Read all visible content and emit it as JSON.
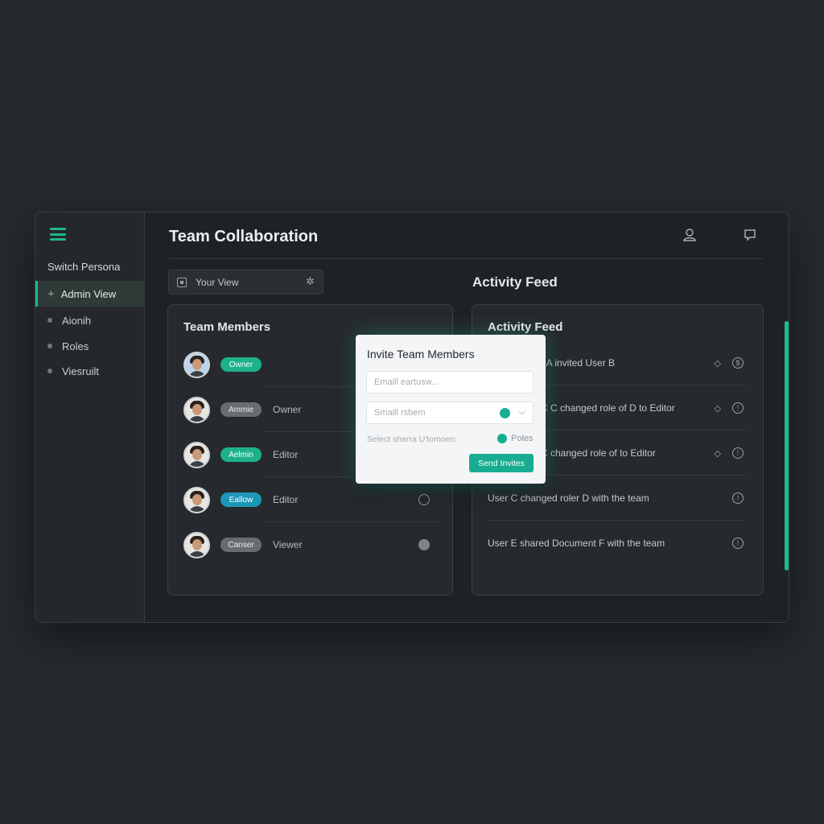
{
  "sidebar": {
    "switch_label": "Switch Persona",
    "items": [
      {
        "label": "Admin View",
        "active": true
      },
      {
        "label": "Aionih"
      },
      {
        "label": "Roles"
      },
      {
        "label": "Viesruilt"
      }
    ]
  },
  "header": {
    "title": "Team Collaboration"
  },
  "view": {
    "label": "Your View"
  },
  "activity": {
    "heading": "Activity Feed",
    "panel_title": "Activity Feed",
    "items": [
      {
        "text": "r A invited User B",
        "diamond": true
      },
      {
        "text": "C C changed role of D to Editor",
        "diamond": true
      },
      {
        "text": "C changed role of to Editor",
        "diamond": true
      },
      {
        "text": "User C changed roler D with the team",
        "diamond": false
      },
      {
        "text": "User E shared Document F with the team",
        "diamond": false
      }
    ]
  },
  "members": {
    "title": "Team Members",
    "rows": [
      {
        "badge": "Owner",
        "badge_style": "green",
        "role": "",
        "radio": "none"
      },
      {
        "badge": "Ammie",
        "badge_style": "grey",
        "role": "Owner",
        "radio": "none"
      },
      {
        "badge": "Aelmin",
        "badge_style": "green",
        "role": "Editor",
        "radio": "none"
      },
      {
        "badge": "Eallow",
        "badge_style": "teal",
        "role": "Editor",
        "radio": "empty"
      },
      {
        "badge": "Canser",
        "badge_style": "grey",
        "role": "Viewer",
        "radio": "filled"
      }
    ]
  },
  "modal": {
    "title": "Invite Team Members",
    "email_placeholder": "Emaill eartusw...",
    "select_placeholder": "Smaill rsbem",
    "select_line": "Select sherra U'tomoen:",
    "roles_label": "Poles",
    "send_label": "Send Invites"
  },
  "colors": {
    "accent": "#1fb98c",
    "background": "#262a2e",
    "panel": "#26292d"
  }
}
